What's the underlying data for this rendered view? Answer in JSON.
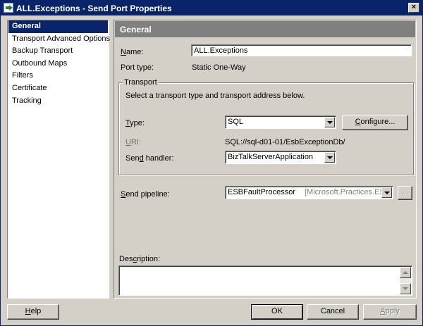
{
  "window": {
    "title": "ALL.Exceptions - Send Port Properties",
    "close_label": "×"
  },
  "nav": {
    "items": [
      {
        "label": "General",
        "selected": true
      },
      {
        "label": "Transport Advanced Options"
      },
      {
        "label": "Backup Transport"
      },
      {
        "label": "Outbound Maps"
      },
      {
        "label": "Filters"
      },
      {
        "label": "Certificate"
      },
      {
        "label": "Tracking"
      }
    ]
  },
  "panel": {
    "header": "General",
    "name": {
      "label_u": "N",
      "label_rest": "ame:",
      "value": "ALL.Exceptions"
    },
    "port_type": {
      "label": "Port type:",
      "value": "Static One-Way"
    },
    "transport": {
      "legend": "Transport",
      "instructions": "Select a transport type and transport address below.",
      "type": {
        "label_u": "T",
        "label_rest": "ype:",
        "value": "SQL"
      },
      "configure_button": {
        "label_u": "C",
        "label_rest": "onfigure..."
      },
      "uri": {
        "label_u": "U",
        "label_rest": "RI:",
        "value": "SQL://sql-d01-01/EsbExceptionDb/"
      },
      "send_handler": {
        "label_pre": "Sen",
        "label_u": "d",
        "label_rest": " handler:",
        "value": "BizTalkServerApplication"
      }
    },
    "send_pipeline": {
      "label_u": "S",
      "label_rest": "end pipeline:",
      "value": "ESBFaultProcessor",
      "assembly": "[Microsoft.Practices.ESB",
      "browse_label": "..."
    },
    "description": {
      "label_pre": "Des",
      "label_u": "c",
      "label_rest": "ription:",
      "value": ""
    }
  },
  "footer": {
    "help": {
      "label_u": "H",
      "label_rest": "elp"
    },
    "ok": "OK",
    "cancel": "Cancel",
    "apply": {
      "label_u": "A",
      "label_rest": "pply"
    }
  },
  "colors": {
    "titlebar": "#0a246a",
    "dialog_bg": "#d4d0c8",
    "panel_header": "#808080",
    "selection": "#0a246a"
  }
}
